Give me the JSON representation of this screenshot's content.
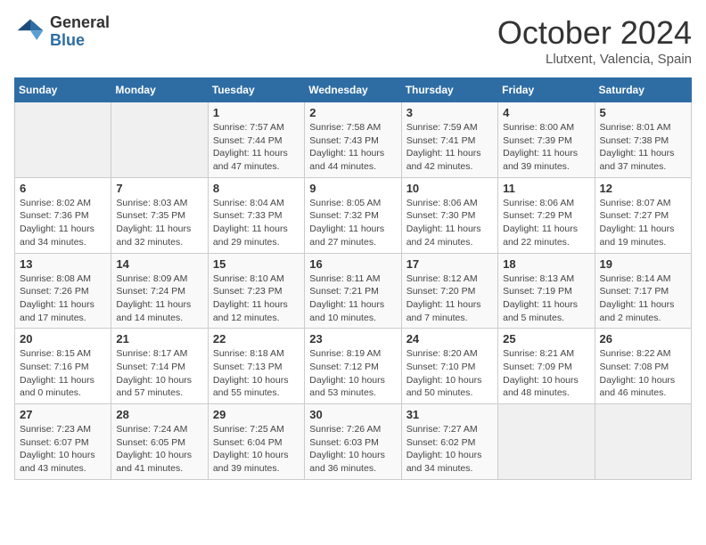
{
  "header": {
    "logo_general": "General",
    "logo_blue": "Blue",
    "month_title": "October 2024",
    "location": "Llutxent, Valencia, Spain"
  },
  "weekdays": [
    "Sunday",
    "Monday",
    "Tuesday",
    "Wednesday",
    "Thursday",
    "Friday",
    "Saturday"
  ],
  "weeks": [
    [
      {
        "day": "",
        "info": ""
      },
      {
        "day": "",
        "info": ""
      },
      {
        "day": "1",
        "info": "Sunrise: 7:57 AM\nSunset: 7:44 PM\nDaylight: 11 hours and 47 minutes."
      },
      {
        "day": "2",
        "info": "Sunrise: 7:58 AM\nSunset: 7:43 PM\nDaylight: 11 hours and 44 minutes."
      },
      {
        "day": "3",
        "info": "Sunrise: 7:59 AM\nSunset: 7:41 PM\nDaylight: 11 hours and 42 minutes."
      },
      {
        "day": "4",
        "info": "Sunrise: 8:00 AM\nSunset: 7:39 PM\nDaylight: 11 hours and 39 minutes."
      },
      {
        "day": "5",
        "info": "Sunrise: 8:01 AM\nSunset: 7:38 PM\nDaylight: 11 hours and 37 minutes."
      }
    ],
    [
      {
        "day": "6",
        "info": "Sunrise: 8:02 AM\nSunset: 7:36 PM\nDaylight: 11 hours and 34 minutes."
      },
      {
        "day": "7",
        "info": "Sunrise: 8:03 AM\nSunset: 7:35 PM\nDaylight: 11 hours and 32 minutes."
      },
      {
        "day": "8",
        "info": "Sunrise: 8:04 AM\nSunset: 7:33 PM\nDaylight: 11 hours and 29 minutes."
      },
      {
        "day": "9",
        "info": "Sunrise: 8:05 AM\nSunset: 7:32 PM\nDaylight: 11 hours and 27 minutes."
      },
      {
        "day": "10",
        "info": "Sunrise: 8:06 AM\nSunset: 7:30 PM\nDaylight: 11 hours and 24 minutes."
      },
      {
        "day": "11",
        "info": "Sunrise: 8:06 AM\nSunset: 7:29 PM\nDaylight: 11 hours and 22 minutes."
      },
      {
        "day": "12",
        "info": "Sunrise: 8:07 AM\nSunset: 7:27 PM\nDaylight: 11 hours and 19 minutes."
      }
    ],
    [
      {
        "day": "13",
        "info": "Sunrise: 8:08 AM\nSunset: 7:26 PM\nDaylight: 11 hours and 17 minutes."
      },
      {
        "day": "14",
        "info": "Sunrise: 8:09 AM\nSunset: 7:24 PM\nDaylight: 11 hours and 14 minutes."
      },
      {
        "day": "15",
        "info": "Sunrise: 8:10 AM\nSunset: 7:23 PM\nDaylight: 11 hours and 12 minutes."
      },
      {
        "day": "16",
        "info": "Sunrise: 8:11 AM\nSunset: 7:21 PM\nDaylight: 11 hours and 10 minutes."
      },
      {
        "day": "17",
        "info": "Sunrise: 8:12 AM\nSunset: 7:20 PM\nDaylight: 11 hours and 7 minutes."
      },
      {
        "day": "18",
        "info": "Sunrise: 8:13 AM\nSunset: 7:19 PM\nDaylight: 11 hours and 5 minutes."
      },
      {
        "day": "19",
        "info": "Sunrise: 8:14 AM\nSunset: 7:17 PM\nDaylight: 11 hours and 2 minutes."
      }
    ],
    [
      {
        "day": "20",
        "info": "Sunrise: 8:15 AM\nSunset: 7:16 PM\nDaylight: 11 hours and 0 minutes."
      },
      {
        "day": "21",
        "info": "Sunrise: 8:17 AM\nSunset: 7:14 PM\nDaylight: 10 hours and 57 minutes."
      },
      {
        "day": "22",
        "info": "Sunrise: 8:18 AM\nSunset: 7:13 PM\nDaylight: 10 hours and 55 minutes."
      },
      {
        "day": "23",
        "info": "Sunrise: 8:19 AM\nSunset: 7:12 PM\nDaylight: 10 hours and 53 minutes."
      },
      {
        "day": "24",
        "info": "Sunrise: 8:20 AM\nSunset: 7:10 PM\nDaylight: 10 hours and 50 minutes."
      },
      {
        "day": "25",
        "info": "Sunrise: 8:21 AM\nSunset: 7:09 PM\nDaylight: 10 hours and 48 minutes."
      },
      {
        "day": "26",
        "info": "Sunrise: 8:22 AM\nSunset: 7:08 PM\nDaylight: 10 hours and 46 minutes."
      }
    ],
    [
      {
        "day": "27",
        "info": "Sunrise: 7:23 AM\nSunset: 6:07 PM\nDaylight: 10 hours and 43 minutes."
      },
      {
        "day": "28",
        "info": "Sunrise: 7:24 AM\nSunset: 6:05 PM\nDaylight: 10 hours and 41 minutes."
      },
      {
        "day": "29",
        "info": "Sunrise: 7:25 AM\nSunset: 6:04 PM\nDaylight: 10 hours and 39 minutes."
      },
      {
        "day": "30",
        "info": "Sunrise: 7:26 AM\nSunset: 6:03 PM\nDaylight: 10 hours and 36 minutes."
      },
      {
        "day": "31",
        "info": "Sunrise: 7:27 AM\nSunset: 6:02 PM\nDaylight: 10 hours and 34 minutes."
      },
      {
        "day": "",
        "info": ""
      },
      {
        "day": "",
        "info": ""
      }
    ]
  ]
}
